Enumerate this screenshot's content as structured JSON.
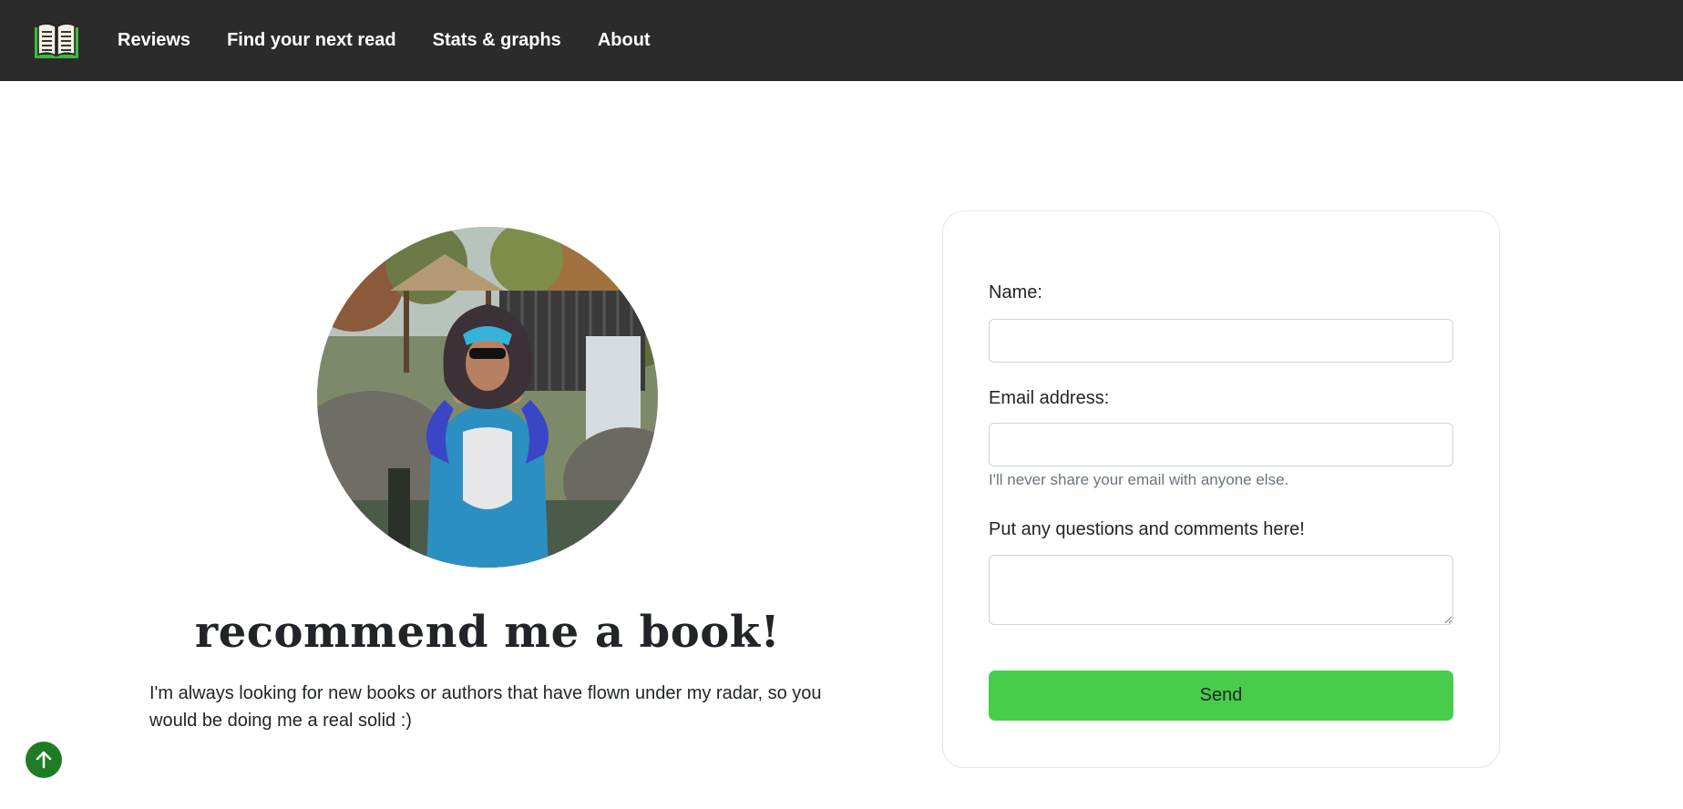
{
  "nav": {
    "logo_icon": "open-book-icon",
    "links": [
      "Reviews",
      "Find your next read",
      "Stats & graphs",
      "About"
    ]
  },
  "profile": {
    "photo": "person in blue animal onesie at zoo",
    "heading": "recommend me a book!",
    "intro": "I'm always looking for new books or authors that have flown under my radar, so you would be doing me a real solid :)"
  },
  "form": {
    "name_label": "Name:",
    "name_value": "",
    "email_label": "Email address:",
    "email_value": "",
    "email_help": "I'll never share your email with anyone else.",
    "comments_label": "Put any questions and comments here!",
    "comments_value": "",
    "send_label": "Send"
  },
  "back_to_top": {
    "icon": "arrow-up-icon"
  },
  "colors": {
    "navbar": "#2b2b2b",
    "accent_green": "#48cc4c",
    "back_to_top_green": "#1e7c24"
  }
}
